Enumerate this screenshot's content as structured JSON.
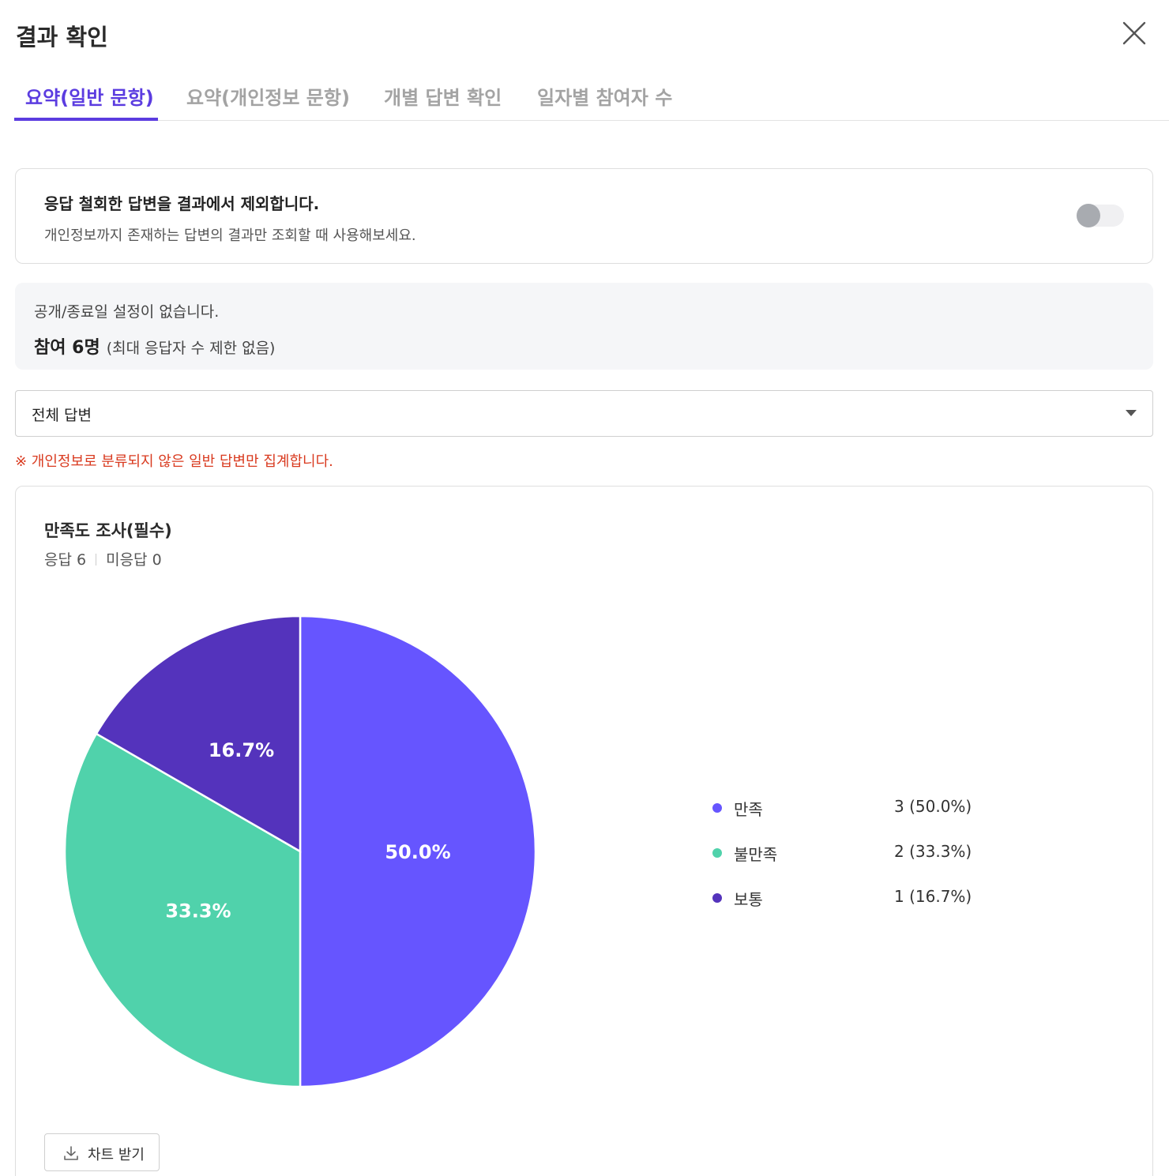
{
  "header": {
    "title": "결과 확인"
  },
  "tabs": [
    {
      "label": "요약(일반 문항)",
      "active": true
    },
    {
      "label": "요약(개인정보 문항)",
      "active": false
    },
    {
      "label": "개별 답변 확인",
      "active": false
    },
    {
      "label": "일자별 참여자 수",
      "active": false
    }
  ],
  "toggle_card": {
    "title": "응답 철회한 답변을 결과에서 제외합니다.",
    "description": "개인정보까지 존재하는 답변의 결과만 조회할 때 사용해보세요.",
    "enabled": false
  },
  "info": {
    "line1": "공개/종료일 설정이 없습니다.",
    "participants": "참여 6명",
    "limit": "(최대 응답자 수 제한 없음)"
  },
  "filter": {
    "selected": "전체 답변"
  },
  "notice": "※ 개인정보로 분류되지 않은 일반 답변만 집계합니다.",
  "question": {
    "title": "만족도 조사(필수)",
    "answered": "응답 6",
    "unanswered": "미응답 0"
  },
  "download": {
    "label": "차트 받기"
  },
  "colors": {
    "accent": "#5b3ce0",
    "satisfied": "#6655ff",
    "unsatisfied": "#50d2ab",
    "neutral": "#5433bc",
    "notice": "#d93a1f"
  },
  "chart_data": {
    "type": "pie",
    "categories": [
      "만족",
      "불만족",
      "보통"
    ],
    "values": [
      3,
      2,
      1
    ],
    "percent_labels": [
      "50.0%",
      "33.3%",
      "16.7%"
    ],
    "legend_values": [
      "3 (50.0%)",
      "2 (33.3%)",
      "1 (16.7%)"
    ],
    "colors": [
      "#6655ff",
      "#50d2ab",
      "#5433bc"
    ],
    "legend": "right"
  }
}
